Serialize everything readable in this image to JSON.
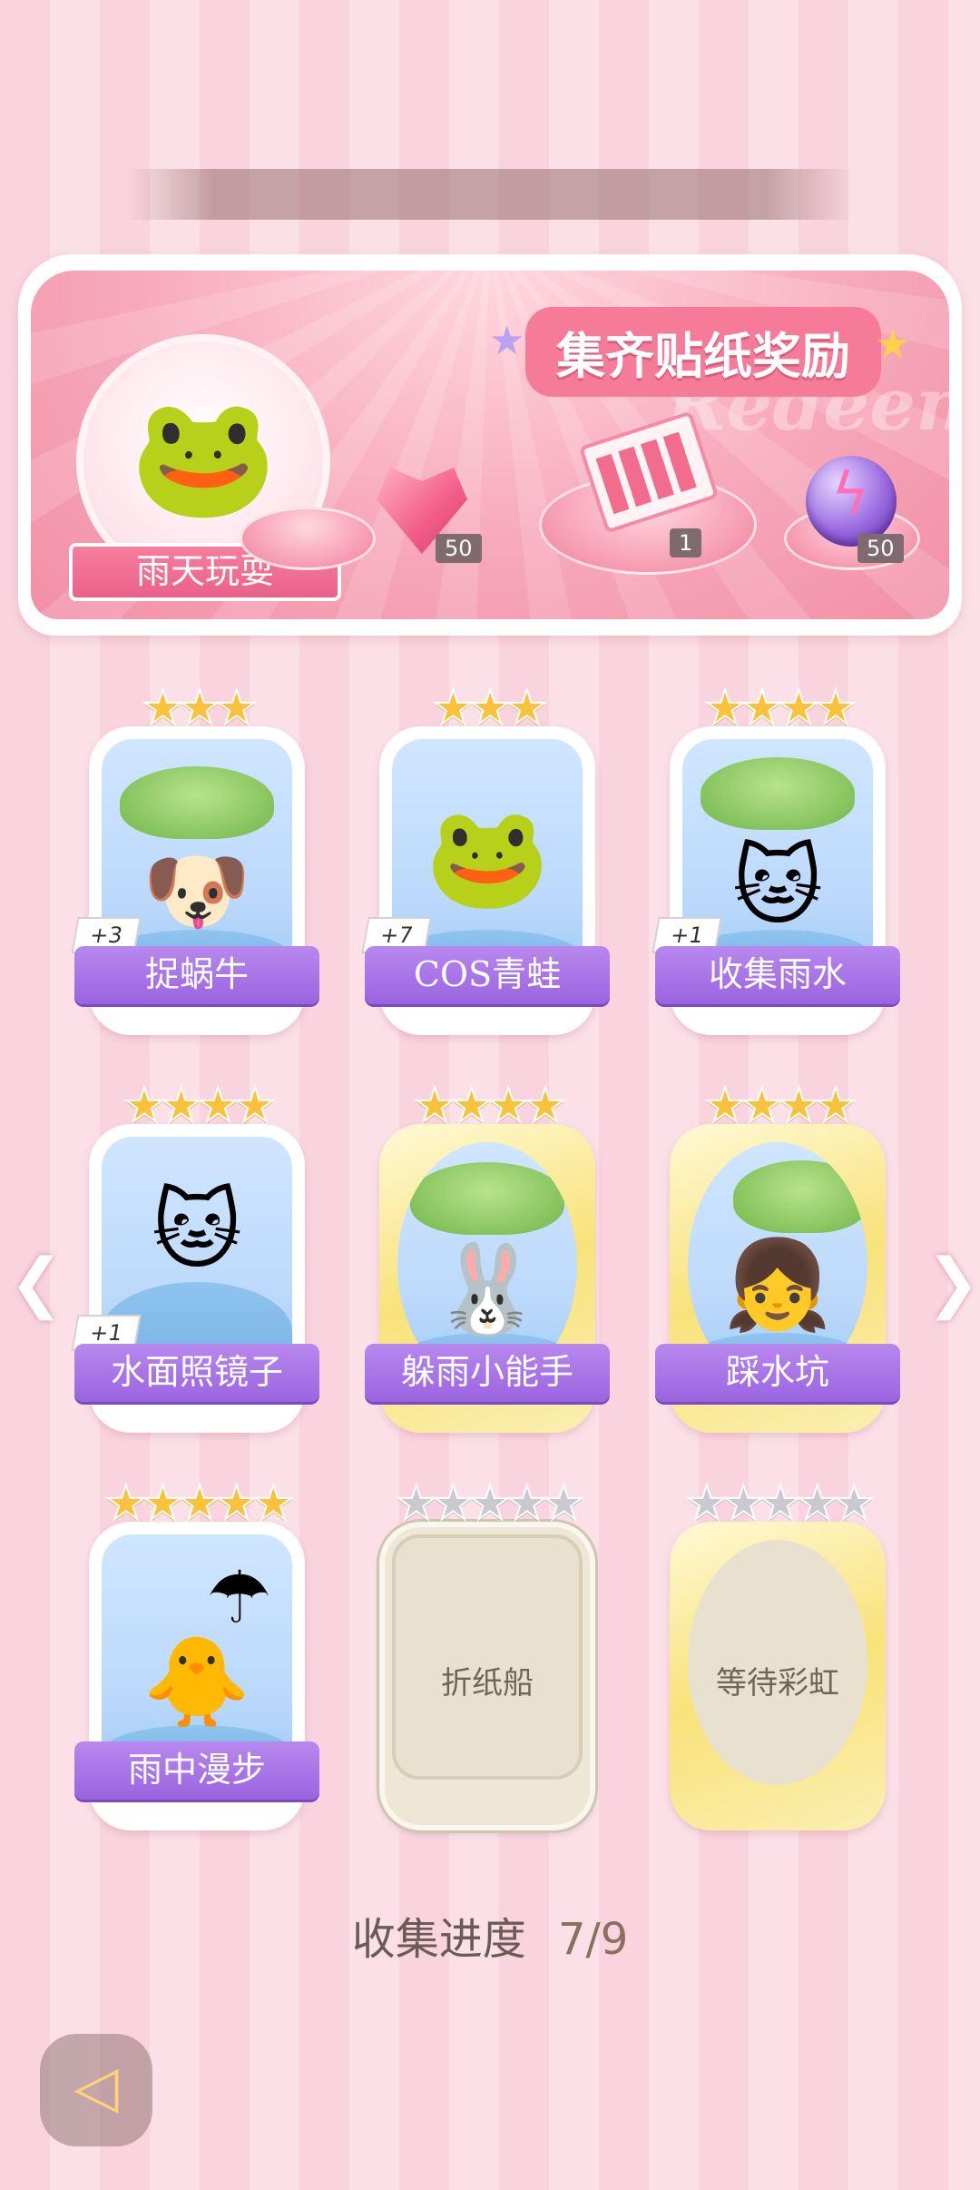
{
  "marquee": {
    "text": ""
  },
  "reward": {
    "title": "集齐贴纸奖励",
    "watermark": "Redeem",
    "album_name": "雨天玩耍",
    "items": [
      {
        "icon": "pink-gem-icon",
        "count": "50"
      },
      {
        "icon": "gift-box-icon",
        "count": "1"
      },
      {
        "icon": "energy-orb-icon",
        "count": "50"
      }
    ]
  },
  "cards": [
    {
      "name": "捉蜗牛",
      "stars": 3,
      "max_stars": 3,
      "bonus": "+3",
      "frame": "white",
      "art": "puppy-snail"
    },
    {
      "name": "COS青蛙",
      "stars": 3,
      "max_stars": 3,
      "bonus": "+7",
      "frame": "white",
      "art": "frog-cat"
    },
    {
      "name": "收集雨水",
      "stars": 4,
      "max_stars": 4,
      "bonus": "+1",
      "frame": "white",
      "art": "calico-leaf"
    },
    {
      "name": "水面照镜子",
      "stars": 4,
      "max_stars": 4,
      "bonus": "+1",
      "frame": "white",
      "art": "calico-mirror"
    },
    {
      "name": "躲雨小能手",
      "stars": 4,
      "max_stars": 4,
      "bonus": "",
      "frame": "gold",
      "art": "bunny-frog"
    },
    {
      "name": "踩水坑",
      "stars": 4,
      "max_stars": 4,
      "bonus": "",
      "frame": "gold",
      "art": "girl-puddle"
    },
    {
      "name": "雨中漫步",
      "stars": 5,
      "max_stars": 5,
      "bonus": "",
      "frame": "white",
      "art": "duck-cat-umbrella"
    },
    {
      "name": "折纸船",
      "stars": 0,
      "max_stars": 5,
      "bonus": "",
      "frame": "locked",
      "art": ""
    },
    {
      "name": "等待彩虹",
      "stars": 0,
      "max_stars": 5,
      "bonus": "",
      "frame": "locked-gold",
      "art": ""
    }
  ],
  "progress": {
    "label": "收集进度",
    "value": "7/9"
  },
  "icons": {
    "back": "back-arrow-icon",
    "prev": "chevron-left-icon",
    "next": "chevron-right-icon"
  },
  "colors": {
    "label_purple": "#9a64e0",
    "star_gold": "#f9c23c",
    "star_empty": "#c9c9cf",
    "accent_pink": "#f57b98"
  }
}
